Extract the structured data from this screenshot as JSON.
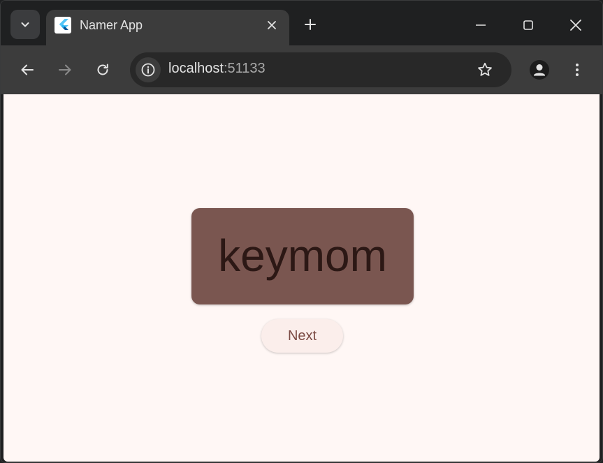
{
  "browser": {
    "tab": {
      "title": "Namer App",
      "favicon": "flutter-logo-icon"
    },
    "address_bar": {
      "host": "localhost",
      "port": ":51133"
    },
    "icons": {
      "tab_search": "chevron-down-icon",
      "tab_close": "close-icon",
      "new_tab": "plus-icon",
      "minimize": "minimize-icon",
      "maximize": "maximize-icon",
      "close_window": "close-icon",
      "back": "arrow-left-icon",
      "forward": "arrow-right-icon",
      "reload": "reload-icon",
      "site_info": "info-icon",
      "bookmark": "star-icon",
      "profile": "person-icon",
      "menu": "kebab-menu-icon"
    }
  },
  "app": {
    "word": "keymom",
    "next_label": "Next"
  },
  "colors": {
    "page_background": "#fff7f5",
    "card_background": "#7a5650",
    "word_text": "#2c1815",
    "button_background": "#fbeeeb",
    "button_text": "#7b4a43"
  }
}
